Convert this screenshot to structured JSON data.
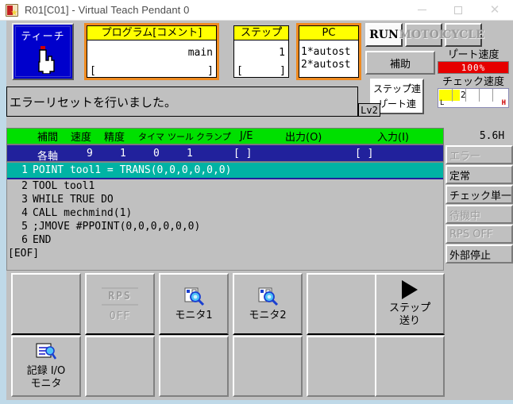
{
  "window": {
    "title": "R01[C01] - Virtual Teach Pendant 0",
    "icon": "app-icon",
    "minimize": "—",
    "maximize": "□",
    "close": "✕"
  },
  "teach": {
    "label": "ティーチ",
    "icon": "hand-pointer-icon"
  },
  "program_panel": {
    "header": "プログラム[コメント]",
    "value": "main",
    "bracket_left": "[",
    "bracket_right": "]"
  },
  "step_panel": {
    "header": "ステップ゚",
    "value": "1",
    "bracket_left": "[",
    "bracket_right": "]"
  },
  "pc_panel": {
    "header": "PC",
    "line1": "1*autost",
    "line2": "2*autost"
  },
  "mode_buttons": [
    {
      "label": "RUN",
      "active": true
    },
    {
      "label": "MOTOR",
      "active": false
    },
    {
      "label": "CYCLE",
      "active": false
    }
  ],
  "aux_button": {
    "label": "補助"
  },
  "repeat_speed": {
    "label": "リ゚ート速度",
    "value": "100%",
    "color": "#e60000"
  },
  "check_speed": {
    "label": "チェック速度",
    "value": "2",
    "min_label": "L",
    "max_label": "H",
    "fill_color": "#ffff00"
  },
  "step_repeat_button": {
    "line1": "ステップ゚連",
    "line2": "リ゚ート連"
  },
  "error_bar": {
    "message": "エラーリセットを行いました。",
    "level": "Lv2"
  },
  "menu_bar": {
    "items": [
      "補間",
      "速度",
      "精度",
      "タイマ",
      "ツール",
      "クランプ゚",
      "J/E",
      "出力(O)",
      "入力(I)"
    ],
    "hour_meter": "5.6H"
  },
  "value_row": {
    "axis_label": "各軸",
    "values": [
      "9",
      "1",
      "0",
      "1"
    ],
    "output_field": "[                 ]",
    "input_field": "[                 ]"
  },
  "code": {
    "selected_line": 1,
    "lines": [
      {
        "no": "1",
        "text": "POINT tool1 = TRANS(0,0,0,0,0,0)"
      },
      {
        "no": "2",
        "text": "TOOL tool1"
      },
      {
        "no": "3",
        "text": "WHILE TRUE DO"
      },
      {
        "no": "4",
        "text": "CALL mechmind(1)"
      },
      {
        "no": "5",
        "text": ";JMOVE #PPOINT(0,0,0,0,0,0)"
      },
      {
        "no": "6",
        "text": "END"
      }
    ],
    "eof": "[EOF]"
  },
  "status_list": [
    {
      "label": "エラー",
      "active": false
    },
    {
      "label": "定常",
      "active": true
    },
    {
      "label": "チェック単一",
      "active": true
    },
    {
      "label": "待機中",
      "active": false
    },
    {
      "label": "RPS OFF",
      "active": false
    },
    {
      "label": "外部停止",
      "active": true
    }
  ],
  "function_keys": [
    {
      "top_label": "",
      "top_icon": "",
      "bottom_label": "記録 I/O\nモニタ",
      "bottom_label_1": "記録 I/O",
      "bottom_label_2": "モニタ",
      "bottom_icon": "document-search-icon"
    },
    {
      "top_label": "OFF",
      "top_icon": "rps-icon",
      "rps_text": "RPS",
      "bottom_label": "",
      "bottom_icon": ""
    },
    {
      "top_label": "モニタ1",
      "top_icon": "monitor-search-icon",
      "bottom_label": "",
      "bottom_icon": ""
    },
    {
      "top_label": "モニタ2",
      "top_icon": "monitor-search-icon",
      "bottom_label": "",
      "bottom_icon": ""
    },
    {
      "top_label": "",
      "top_icon": "",
      "bottom_label": "",
      "bottom_icon": ""
    },
    {
      "top_label_1": "ステップ゚",
      "top_label_2": "送り",
      "top_icon": "play-triangle-icon",
      "bottom_label": "",
      "bottom_icon": ""
    }
  ]
}
